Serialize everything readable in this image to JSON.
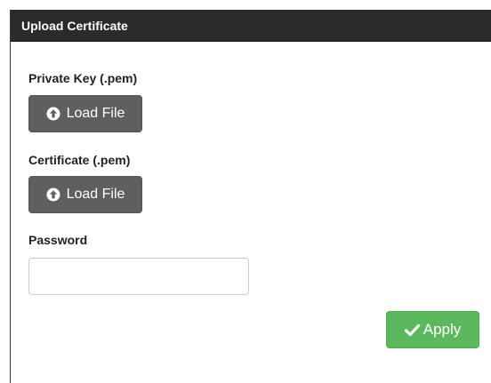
{
  "dialog": {
    "title": "Upload Certificate"
  },
  "private_key": {
    "label": "Private Key (.pem)",
    "button_label": "Load File",
    "button_icon": "circle-arrow-up-icon"
  },
  "certificate": {
    "label": "Certificate (.pem)",
    "button_label": "Load File",
    "button_icon": "circle-arrow-up-icon"
  },
  "password": {
    "label": "Password",
    "value": "",
    "placeholder": ""
  },
  "apply": {
    "label": "Apply",
    "icon": "checkmark-icon"
  },
  "colors": {
    "header_bg": "#2b2b2b",
    "load_button_bg": "#5f5f5f",
    "apply_button_bg": "#5cb85c"
  }
}
